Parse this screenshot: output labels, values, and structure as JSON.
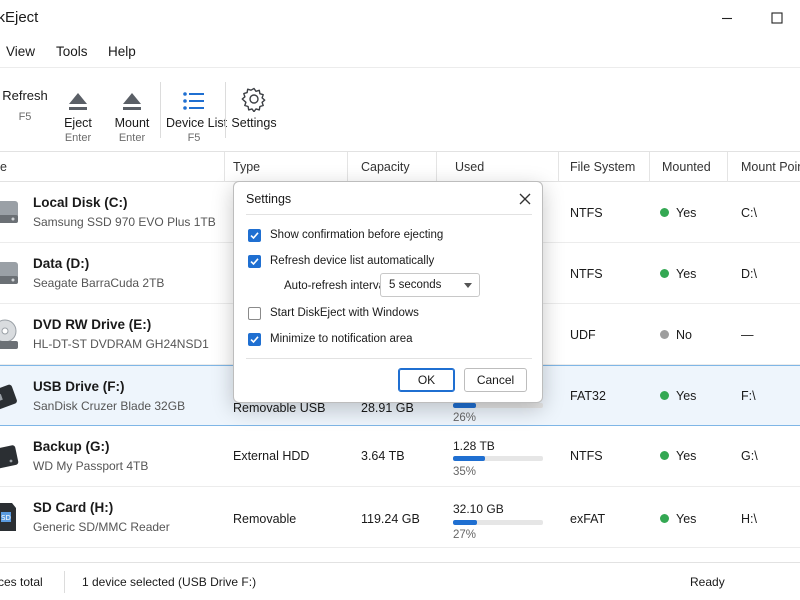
{
  "window": {
    "title": "skEject"
  },
  "menu": {
    "items": [
      "View",
      "Tools",
      "Help"
    ]
  },
  "toolbar": {
    "refresh": {
      "label": "Refresh",
      "key": "F5"
    },
    "eject": {
      "label": "Eject",
      "key": "Enter"
    },
    "mount": {
      "label": "Mount",
      "key": "Enter"
    },
    "device_list": {
      "label": "Device List",
      "key": "F5"
    },
    "settings": {
      "label": "Settings"
    }
  },
  "table": {
    "headers": {
      "name": "e",
      "type": "Type",
      "capacity": "Capacity",
      "used": "Used",
      "filesystem": "File System",
      "mounted": "Mounted",
      "mountpoint": "Mount Point"
    },
    "rows": [
      {
        "name": "Local Disk (C:)",
        "desc": "Samsung SSD 970 EVO Plus 1TB",
        "type": "",
        "capacity": "",
        "used": "",
        "pct": "",
        "fs": "NTFS",
        "mounted": "Yes",
        "mounted_state": "on",
        "mountpoint": "C:\\",
        "icon": "hard-drive-icon"
      },
      {
        "name": "Data (D:)",
        "desc": "Seagate BarraCuda 2TB",
        "type": "",
        "capacity": "",
        "used": "",
        "pct": "",
        "fs": "NTFS",
        "mounted": "Yes",
        "mounted_state": "on",
        "mountpoint": "D:\\",
        "icon": "hard-drive-icon"
      },
      {
        "name": "DVD RW Drive (E:)",
        "desc": "HL-DT-ST DVDRAM GH24NSD1",
        "type": "",
        "capacity": "",
        "used": "",
        "pct": "",
        "fs": "UDF",
        "mounted": "No",
        "mounted_state": "off",
        "mountpoint": "—",
        "icon": "optical-drive-icon"
      },
      {
        "name": "USB Drive (F:)",
        "desc": "SanDisk Cruzer Blade 32GB",
        "type": "Removable USB",
        "capacity": "28.91 GB",
        "used": "",
        "pct": "26%",
        "fs": "FAT32",
        "mounted": "Yes",
        "mounted_state": "on",
        "mountpoint": "F:\\",
        "icon": "usb-drive-icon",
        "used_fraction": 0.26
      },
      {
        "name": "Backup (G:)",
        "desc": "WD My Passport 4TB",
        "type": "External HDD",
        "capacity": "3.64 TB",
        "used": "1.28 TB",
        "pct": "35%",
        "fs": "NTFS",
        "mounted": "Yes",
        "mounted_state": "on",
        "mountpoint": "G:\\",
        "icon": "external-drive-icon",
        "used_fraction": 0.35
      },
      {
        "name": "SD Card (H:)",
        "desc": "Generic SD/MMC Reader",
        "type": "Removable",
        "capacity": "119.24 GB",
        "used": "32.10 GB",
        "pct": "27%",
        "fs": "exFAT",
        "mounted": "Yes",
        "mounted_state": "on",
        "mountpoint": "H:\\",
        "icon": "sd-card-icon",
        "used_fraction": 0.27
      }
    ]
  },
  "status": {
    "total": "ces total",
    "selected": "1 device selected (USB Drive F:)",
    "state": "Ready"
  },
  "dialog": {
    "title": "Settings",
    "options": [
      {
        "label": "Show confirmation before ejecting",
        "checked": true
      },
      {
        "label": "Refresh device list automatically",
        "checked": true
      },
      {
        "label": "Start DiskEject with Windows",
        "checked": false
      },
      {
        "label": "Minimize to notification area",
        "checked": true
      }
    ],
    "interval_label": "Auto-refresh interval:",
    "interval_value": "5 seconds",
    "ok": "OK",
    "cancel": "Cancel"
  },
  "colors": {
    "accent": "#1f6fd1",
    "mounted": "#34a853",
    "unmounted": "#9e9e9e",
    "selection": "#eef5fc"
  }
}
